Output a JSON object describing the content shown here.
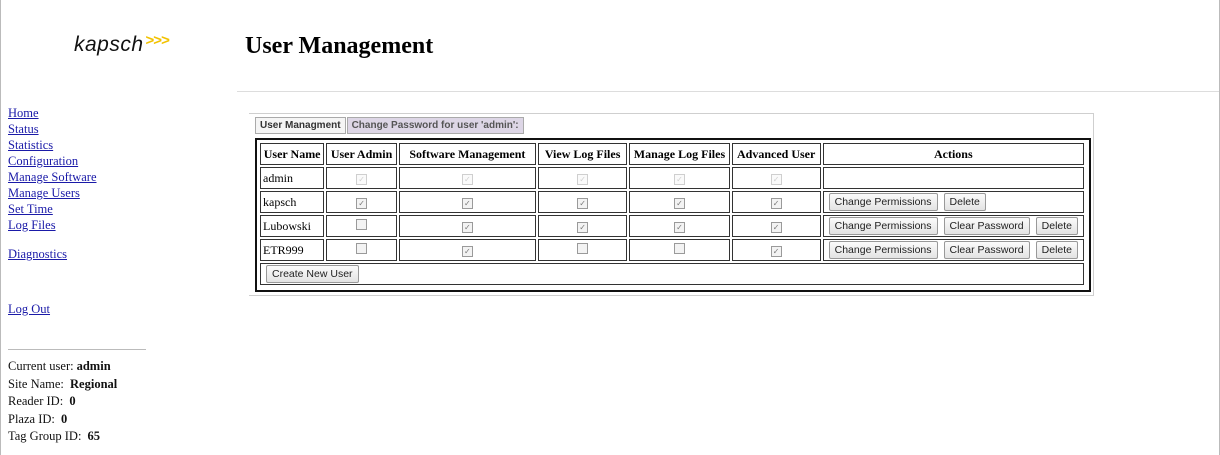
{
  "logo": {
    "text": "kapsch",
    "chevrons": ">>>",
    "accent_color": "#f2c200"
  },
  "page_title": "User Management",
  "nav": {
    "items": [
      "Home",
      "Status",
      "Statistics",
      "Configuration",
      "Manage Software",
      "Manage Users",
      "Set Time",
      "Log Files"
    ],
    "diagnostics": "Diagnostics",
    "logout": "Log Out"
  },
  "info": {
    "current_user_label": "Current user:",
    "current_user": "admin",
    "site_name_label": "Site Name:",
    "site_name": "Regional",
    "reader_id_label": "Reader ID:",
    "reader_id": "0",
    "plaza_id_label": "Plaza ID:",
    "plaza_id": "0",
    "tag_group_label": "Tag Group ID:",
    "tag_group": "65"
  },
  "tabs": [
    "User Managment",
    "Change Password for user 'admin':"
  ],
  "table": {
    "headers": [
      "User Name",
      "User Admin",
      "Software Management",
      "View Log Files",
      "Manage Log Files",
      "Advanced User",
      "Actions"
    ],
    "rows": [
      {
        "name": "admin",
        "checks": [
          true,
          true,
          true,
          true,
          true
        ],
        "disabled": true,
        "actions": []
      },
      {
        "name": "kapsch",
        "checks": [
          true,
          true,
          true,
          true,
          true
        ],
        "disabled": false,
        "actions": [
          "Change Permissions",
          "Delete"
        ]
      },
      {
        "name": "Lubowski",
        "checks": [
          false,
          true,
          true,
          true,
          true
        ],
        "disabled": false,
        "actions": [
          "Change Permissions",
          "Clear Password",
          "Delete"
        ]
      },
      {
        "name": "ETR999",
        "checks": [
          false,
          true,
          false,
          false,
          true
        ],
        "disabled": false,
        "actions": [
          "Change Permissions",
          "Clear Password",
          "Delete"
        ]
      }
    ],
    "create_button": "Create New User"
  },
  "icons": {
    "checkbox_checked": "check-icon"
  }
}
